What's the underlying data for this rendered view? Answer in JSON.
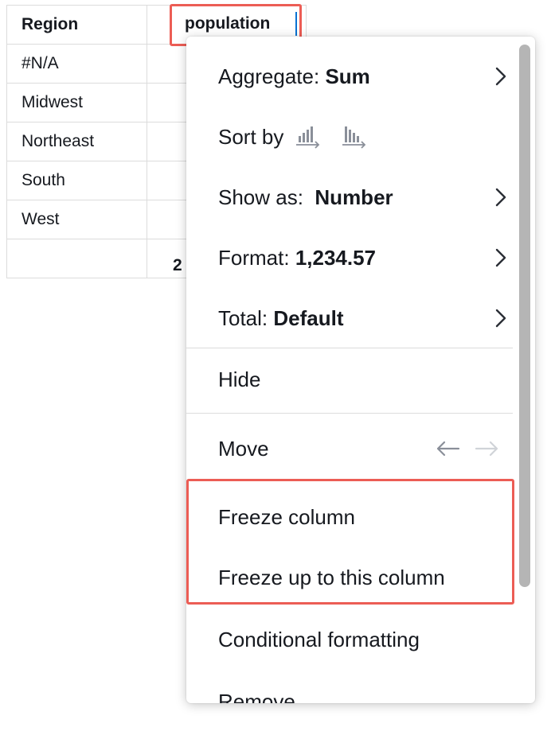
{
  "table": {
    "headers": [
      "Region",
      "population"
    ],
    "rows": [
      "#N/A",
      "Midwest",
      "Northeast",
      "South",
      "West"
    ],
    "total_partial": "2"
  },
  "menu": {
    "aggregate": {
      "label": "Aggregate: ",
      "value": "Sum"
    },
    "sort_by": "Sort by",
    "show_as": {
      "label": "Show as: ",
      "value": "Number"
    },
    "format": {
      "label": "Format: ",
      "value": "1,234.57"
    },
    "total": {
      "label": "Total: ",
      "value": "Default"
    },
    "hide": "Hide",
    "move": "Move",
    "freeze_column": "Freeze column",
    "freeze_up_to": "Freeze up to this column",
    "conditional_formatting": "Conditional formatting",
    "remove": "Remove"
  },
  "icons": {
    "submenu": "chevron-right-icon",
    "sort_asc": "sort-ascending-icon",
    "sort_desc": "sort-descending-icon",
    "move_left": "arrow-left-icon",
    "move_right": "arrow-right-icon"
  },
  "colors": {
    "highlight": "#ec5d55",
    "accent": "#0972d3",
    "text": "#16191f",
    "icon_muted": "#8a8f99"
  }
}
